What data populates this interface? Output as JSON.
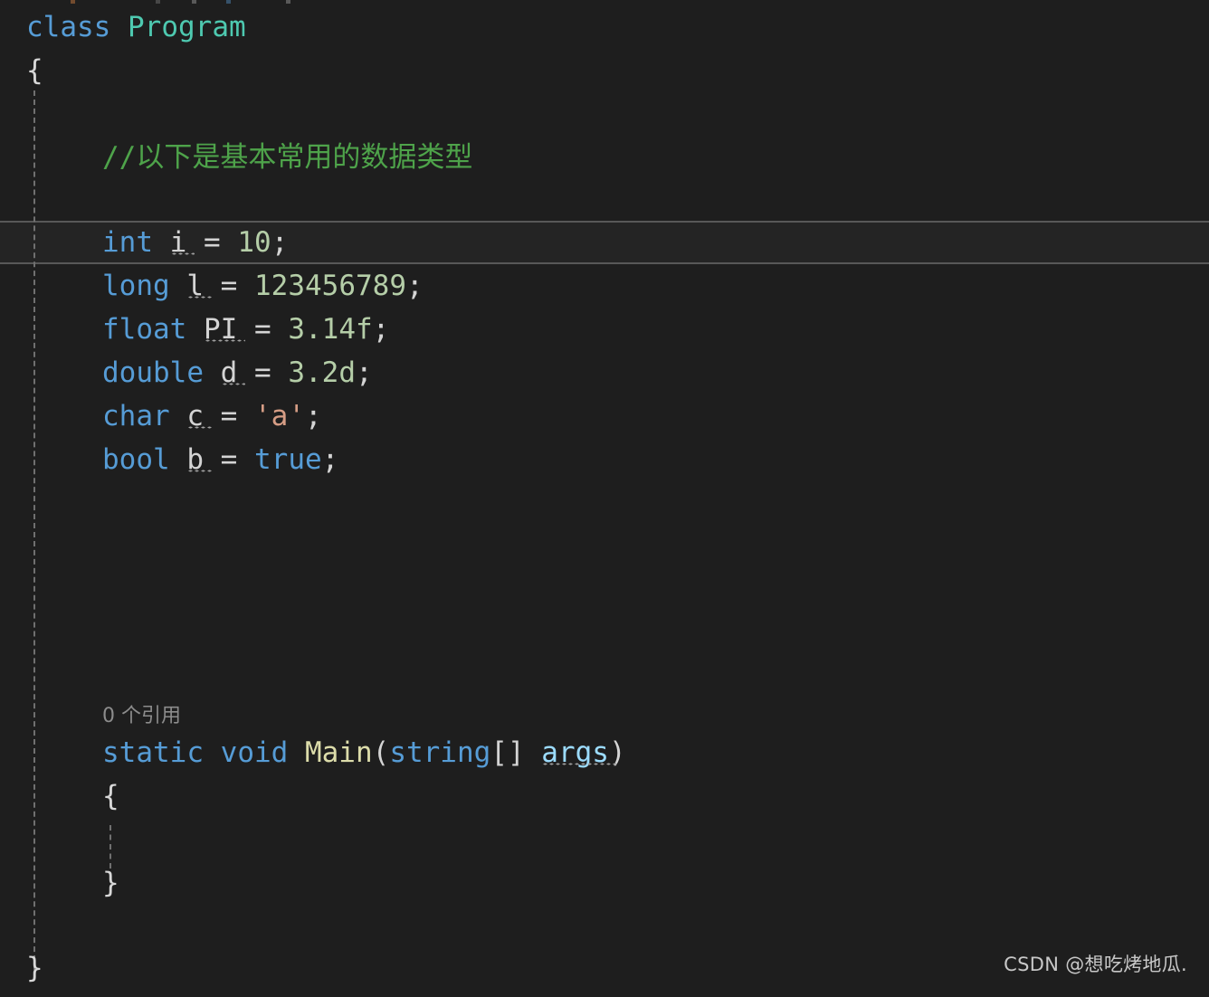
{
  "editor": {
    "theme_name": "dark",
    "background_color": "#1e1e1e",
    "current_line_background": "#242424",
    "current_line_border_color": "#585858",
    "indent_guide_color": "#707070",
    "language": "csharp",
    "current_line_number": 5
  },
  "colors": {
    "keyword": "#569cd6",
    "type": "#4ec9b0",
    "comment": "#4ea34a",
    "number": "#b5cea8",
    "string": "#d69d85",
    "method": "#dcdcaa",
    "parameter": "#9cdcfe",
    "plain": "#d4d4d4",
    "brace": "#d8d8d8",
    "codelens": "#8c8c8c",
    "watermark": "#c8c8c8"
  },
  "code": {
    "line1": {
      "keyword_class": "class",
      "space": " ",
      "type_name": "Program"
    },
    "line2": {
      "brace": "{"
    },
    "line3": {
      "comment": "//以下是基本常用的数据类型"
    },
    "line5": {
      "keyword": "int",
      "sp1": " ",
      "name": "i",
      "sp2": " ",
      "op": "=",
      "sp3": " ",
      "value": "10",
      "semi": ";"
    },
    "line6": {
      "keyword": "long",
      "sp1": " ",
      "name": "l",
      "sp2": " ",
      "op": "=",
      "sp3": " ",
      "value": "123456789",
      "semi": ";"
    },
    "line7": {
      "keyword": "float",
      "sp1": " ",
      "name": "PI",
      "sp2": " ",
      "op": "=",
      "sp3": " ",
      "value": "3.14f",
      "semi": ";"
    },
    "line8": {
      "keyword": "double",
      "sp1": " ",
      "name": "d",
      "sp2": " ",
      "op": "=",
      "sp3": " ",
      "value": "3.2d",
      "semi": ";"
    },
    "line9": {
      "keyword": "char",
      "sp1": " ",
      "name": "c",
      "sp2": " ",
      "op": "=",
      "sp3": " ",
      "value": "'a'",
      "semi": ";"
    },
    "line10": {
      "keyword": "bool",
      "sp1": " ",
      "name": "b",
      "sp2": " ",
      "op": "=",
      "sp3": " ",
      "value": "true",
      "semi": ";"
    },
    "codelens": {
      "text": "0 个引用"
    },
    "line_main": {
      "mod": "static",
      "sp1": " ",
      "ret": "void",
      "sp2": " ",
      "method": "Main",
      "paren_open": "(",
      "param_type": "string",
      "brackets": "[]",
      "sp3": " ",
      "param_name": "args",
      "paren_close": ")"
    },
    "line_main_open": {
      "brace": "{"
    },
    "line_main_close": {
      "brace": "}"
    },
    "line_class_close": {
      "brace": "}"
    }
  },
  "watermark": {
    "text": "CSDN @想吃烤地瓜."
  }
}
